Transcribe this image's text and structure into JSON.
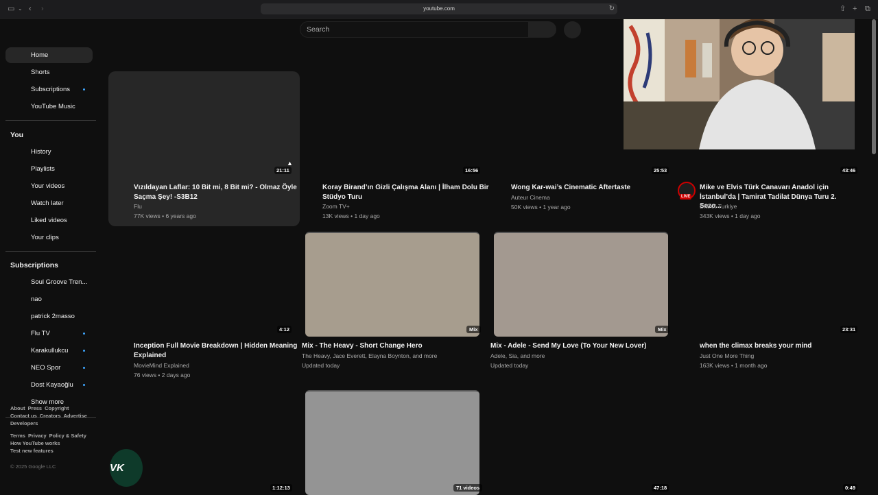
{
  "browser": {
    "url": "youtube.com"
  },
  "search": {
    "placeholder": "Search"
  },
  "sidebar": {
    "main": [
      {
        "label": "Home",
        "active": true
      },
      {
        "label": "Shorts"
      },
      {
        "label": "Subscriptions",
        "dot": true
      },
      {
        "label": "YouTube Music"
      }
    ],
    "you_heading": "You",
    "you": [
      "History",
      "Playlists",
      "Your videos",
      "Watch later",
      "Liked videos",
      "Your clips"
    ],
    "subs_heading": "Subscriptions",
    "subs": [
      {
        "label": "Soul Groove Tren..."
      },
      {
        "label": "nao"
      },
      {
        "label": "patrick 2masso"
      },
      {
        "label": "Flu TV",
        "dot": true
      },
      {
        "label": "Karakullukcu",
        "dot": true
      },
      {
        "label": "NEO Spor",
        "dot": true
      },
      {
        "label": "Dost Kayaoğlu",
        "dot": true
      },
      {
        "label": "Show more"
      }
    ],
    "footer": {
      "row1": [
        "About",
        "Press",
        "Copyright"
      ],
      "row2": [
        "Contact us",
        "Creators",
        "Advertise"
      ],
      "row3": [
        "Developers"
      ],
      "row4": [
        "Terms",
        "Privacy",
        "Policy & Safety"
      ],
      "row5": [
        "How YouTube works"
      ],
      "row6": [
        "Test new features"
      ],
      "copyright": "© 2025 Google LLC"
    }
  },
  "videos": [
    {
      "title": "Vızıldayan Laflar: 10 Bit mi, 8 Bit mi? - Olmaz Öyle Saçma Şey! -S3B12",
      "channel": "Flu",
      "meta": "77K views • 6 years ago",
      "duration": "21:11"
    },
    {
      "title": "Koray Birand’ın Gizli Çalışma Alanı | İlham Dolu Bir Stüdyo Turu",
      "channel": "Zoom TV+",
      "meta": "13K views • 1 day ago",
      "duration": "16:56"
    },
    {
      "title": "Wong Kar-wai’s Cinematic Aftertaste",
      "channel": "Auteur Cinema",
      "meta": "50K views • 1 year ago",
      "duration": "25:53"
    },
    {
      "title": "Mike ve Elvis Türk Canavarı Anadol için İstanbul’da | Tamirat Tadilat Dünya Turu 2. Sezo...",
      "channel": "DMAX Turkiye",
      "meta": "343K views • 1 day ago",
      "duration": "43:46",
      "live": "LIVE"
    },
    {
      "title": "Inception Full Movie Breakdown | Hidden Meaning Explained",
      "channel": "MovieMind Explained",
      "meta": "76 views • 2 days ago",
      "duration": "4:12"
    },
    {
      "title": "Mix - The Heavy - Short Change Hero",
      "channel": "The Heavy, Jace Everett, Elayna Boynton, and more",
      "meta": "Updated today",
      "badge": "Mix"
    },
    {
      "title": "Mix - Adele - Send My Love (To Your New Lover)",
      "channel": "Adele, Sia, and more",
      "meta": "Updated today",
      "badge": "Mix"
    },
    {
      "title": "when the climax breaks your mind",
      "channel": "Just One More Thing",
      "meta": "163K views • 1 month ago",
      "duration": "23:31"
    },
    {
      "duration": "1:12:13",
      "thumb_text": "VK"
    },
    {
      "badge": "71 videos"
    },
    {
      "duration": "47:18"
    },
    {
      "duration": "0:49"
    }
  ],
  "colors": {
    "background": "#0f0f0f",
    "accent_dot": "#3ea6ff",
    "live": "#cc0000"
  }
}
